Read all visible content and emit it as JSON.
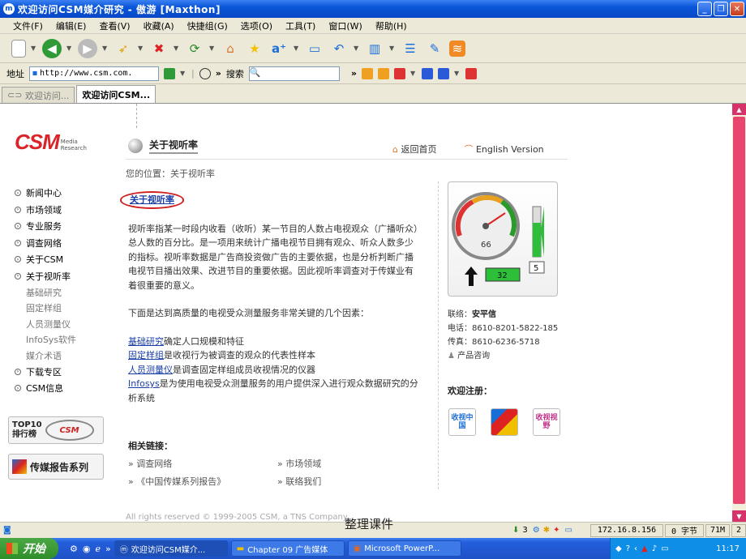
{
  "window": {
    "title": "欢迎访问CSM媒介研究 - 傲游 [Maxthon]"
  },
  "menu": [
    "文件(F)",
    "编辑(E)",
    "查看(V)",
    "收藏(A)",
    "快捷组(G)",
    "选项(O)",
    "工具(T)",
    "窗口(W)",
    "帮助(H)"
  ],
  "address": {
    "label": "地址",
    "value": "http://www.csm.com.",
    "search_label": "搜索"
  },
  "tabs": [
    "欢迎访问...",
    "欢迎访问CSM..."
  ],
  "logo": {
    "text": "CSM",
    "sub1": "Media",
    "sub2": "Research"
  },
  "nav": {
    "items": [
      "新闻中心",
      "市场领域",
      "专业服务",
      "调查网络",
      "关于CSM",
      "关于视听率"
    ],
    "subitems": [
      "基础研究",
      "固定样组",
      "人员测量仪",
      "InfoSys软件",
      "媒介术语"
    ],
    "items2": [
      "下载专区",
      "CSM信息"
    ]
  },
  "badges": {
    "top10": "TOP10",
    "rank": "排行榜",
    "report": "传媒报告系列"
  },
  "header": {
    "title": "关于视听率",
    "home": "返回首页",
    "english": "English Version"
  },
  "breadcrumb": "您的位置：关于视听率",
  "article": {
    "heading": "关于视听率",
    "para1": "视听率指某一时段内收看（收听）某一节目的人数占电视观众（广播听众）总人数的百分比。是一项用来统计广播电视节目拥有观众、听众人数多少的指标。视听率数据是广告商投资做广告的主要依据，也是分析判断广播电视节目播出效果、改进节目的重要依据。因此视听率调查对于传媒业有着很重要的意义。",
    "para2": "下面是达到高质量的电视受众测量服务非常关键的几个因素：",
    "factors": [
      {
        "link": "基础研究",
        "text": "确定人口规模和特征"
      },
      {
        "link": "固定样组",
        "text": "是收视行为被调查的观众的代表性样本"
      },
      {
        "link": "人员测量仪",
        "text": "是调查固定样组成员收视情况的仪器"
      },
      {
        "link": "Infosys",
        "text": "是为使用电视受众测量服务的用户提供深入进行观众数据研究的分析系统"
      }
    ]
  },
  "gauge": {
    "dial": "66",
    "counter": "32",
    "level": "5"
  },
  "contact": {
    "label": "联络：",
    "name": "安平信",
    "phone_label": "电话：",
    "phone": "8610-8201-5822-185",
    "fax_label": "传真：",
    "fax": "8610-6236-5718",
    "consult": "产品咨询"
  },
  "welcome": "欢迎注册：",
  "reg_icons": [
    "收视中国",
    "",
    "收视视野"
  ],
  "related": {
    "title": "相关链接：",
    "links": [
      "调查网络",
      "市场领域",
      "《中国传媒系列报告》",
      "联络我们"
    ]
  },
  "footer": "All rights reserved © 1999-2005 CSM, a TNS Company",
  "watermark": "整理课件",
  "status": {
    "count": "3",
    "ip": "172.16.8.156",
    "bytes": "0 字节",
    "mem": "71M",
    "num": "2"
  },
  "taskbar": {
    "start": "开始",
    "tasks": [
      "欢迎访问CSM媒介...",
      "Chapter 09 广告媒体",
      "Microsoft PowerP..."
    ],
    "clock": "11:17"
  }
}
